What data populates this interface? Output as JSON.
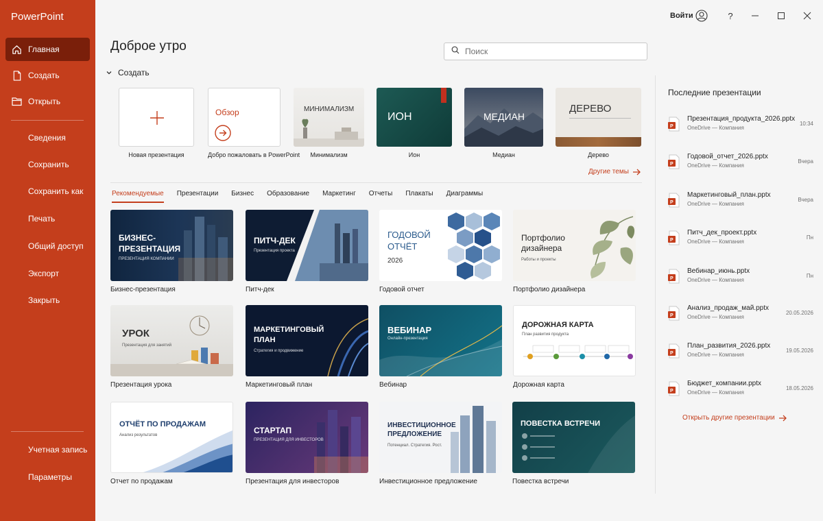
{
  "app": {
    "title": "PowerPoint"
  },
  "titlebar": {
    "sign_in": "Войти"
  },
  "nav": {
    "top": [
      {
        "label": "Главная",
        "icon": "home-icon",
        "active": true
      },
      {
        "label": "Создать",
        "icon": "new-file-icon"
      },
      {
        "label": "Открыть",
        "icon": "folder-icon"
      }
    ],
    "middle": [
      "Сведения",
      "Сохранить",
      "Сохранить как",
      "Печать",
      "Общий доступ",
      "Экспорт",
      "Закрыть"
    ],
    "bottom": [
      "Учетная запись",
      "Параметры"
    ]
  },
  "main": {
    "greeting": "Доброе утро",
    "search_placeholder": "Поиск",
    "create_label": "Создать",
    "themes": [
      {
        "caption": "Новая презентация"
      },
      {
        "caption": "Добро пожаловать в PowerPoint",
        "thumb_title": "Обзор"
      },
      {
        "caption": "Минимализм",
        "thumb_title": "МИНИМАЛИЗМ"
      },
      {
        "caption": "Ион",
        "thumb_title": "ИОН"
      },
      {
        "caption": "Медиан",
        "thumb_title": "МЕДИАН"
      },
      {
        "caption": "Дерево",
        "thumb_title": "ДЕРЕВО"
      }
    ],
    "more_themes": "Другие темы",
    "tabs": [
      "Рекомендуемые",
      "Презентации",
      "Бизнес",
      "Образование",
      "Маркетинг",
      "Отчеты",
      "Плакаты",
      "Диаграммы"
    ],
    "templates": [
      {
        "caption": "Бизнес-презентация",
        "title": "БИЗНЕС-ПРЕЗЕНТАЦИЯ",
        "sub": "ПРЕЗЕНТАЦИЯ КОМПАНИИ"
      },
      {
        "caption": "Питч-дек",
        "title": "ПИТЧ-ДЕК",
        "sub": "Презентация проекта"
      },
      {
        "caption": "Годовой отчет",
        "title": "ГОДОВОЙ ОТЧЁТ",
        "sub": "2026"
      },
      {
        "caption": "Портфолио дизайнера",
        "title": "Портфолио дизайнера",
        "sub": "Работы и проекты"
      },
      {
        "caption": "Презентация урока",
        "title": "УРОК",
        "sub": "Презентация для занятий"
      },
      {
        "caption": "Маркетинговый план",
        "title": "МАРКЕТИНГОВЫЙ ПЛАН",
        "sub": "Стратегия и продвижение"
      },
      {
        "caption": "Вебинар",
        "title": "ВЕБИНАР",
        "sub": "Онлайн-презентация"
      },
      {
        "caption": "Дорожная карта",
        "title": "ДОРОЖНАЯ КАРТА",
        "sub": "План развития продукта"
      },
      {
        "caption": "Отчет по продажам",
        "title": "ОТЧЁТ ПО ПРОДАЖАМ",
        "sub": "Анализ результатов"
      },
      {
        "caption": "Презентация для инвесторов",
        "title": "СТАРТАП",
        "sub": "ПРЕЗЕНТАЦИЯ ДЛЯ ИНВЕСТОРОВ"
      },
      {
        "caption": "Инвестиционное предложение",
        "title": "ИНВЕСТИЦИОННОЕ ПРЕДЛОЖЕНИЕ",
        "sub": "Потенциал. Стратегия. Рост."
      },
      {
        "caption": "Повестка встречи",
        "title": "ПОВЕСТКА ВСТРЕЧИ"
      }
    ]
  },
  "recent": {
    "title": "Последние презентации",
    "items": [
      {
        "name": "Презентация_продукта_2026.pptx",
        "location": "OneDrive — Компания",
        "date": "10:34"
      },
      {
        "name": "Годовой_отчет_2026.pptx",
        "location": "OneDrive — Компания",
        "date": "Вчера"
      },
      {
        "name": "Маркетинговый_план.pptx",
        "location": "OneDrive — Компания",
        "date": "Вчера"
      },
      {
        "name": "Питч_дек_проект.pptx",
        "location": "OneDrive — Компания",
        "date": "Пн"
      },
      {
        "name": "Вебинар_июнь.pptx",
        "location": "OneDrive — Компания",
        "date": "Пн"
      },
      {
        "name": "Анализ_продаж_май.pptx",
        "location": "OneDrive — Компания",
        "date": "20.05.2026"
      },
      {
        "name": "План_развития_2026.pptx",
        "location": "OneDrive — Компания",
        "date": "19.05.2026"
      },
      {
        "name": "Бюджет_компании.pptx",
        "location": "OneDrive — Компания",
        "date": "18.05.2026"
      }
    ],
    "open_more": "Открыть другие презентации"
  },
  "colors": {
    "accent": "#c43e1c",
    "sidebar_active": "#7a1f0a"
  }
}
